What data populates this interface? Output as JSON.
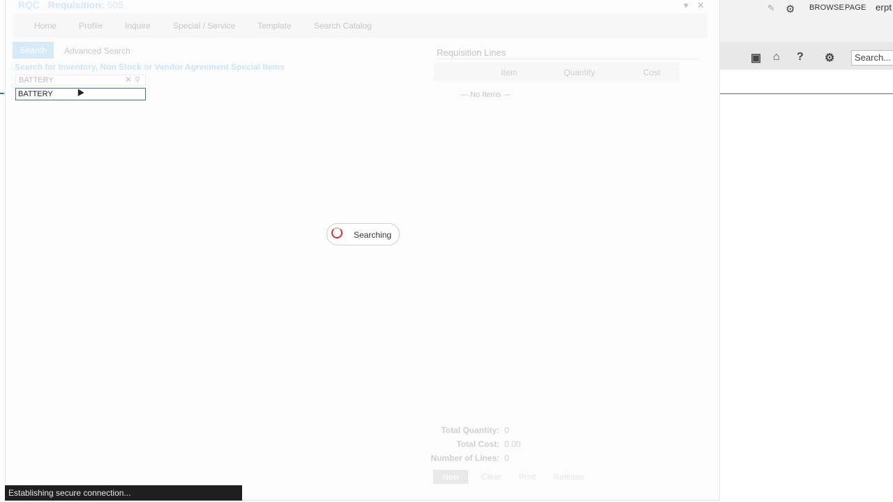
{
  "background": {
    "topbar": {
      "browse": "BROWSE",
      "page": "PAGE",
      "user": "erpt"
    },
    "ribbon": {
      "search_placeholder": "Search..."
    }
  },
  "modal": {
    "code": "RQC",
    "title_label": "Requisition:",
    "title_number": "505",
    "nav": [
      "Home",
      "Profile",
      "Inquire",
      "Special / Service",
      "Template",
      "Search Catalog"
    ],
    "tabs": {
      "search": "Search",
      "advanced": "Advanced Search"
    },
    "subtitle": "Search for Inventory, Non Stock or Vendor Agreement Special Items",
    "search": {
      "value": "BATTERY"
    },
    "autocomplete": [
      "BATTERY"
    ],
    "requisition_lines": {
      "title": "Requisition Lines",
      "columns": [
        "Item",
        "Quantity",
        "Cost"
      ],
      "empty": "--- No Items ---"
    },
    "totals": [
      {
        "label": "Total Quantity:",
        "value": "0"
      },
      {
        "label": "Total Cost:",
        "value": "0.00"
      },
      {
        "label": "Number of Lines:",
        "value": "0"
      }
    ],
    "buttons": {
      "new": "New",
      "clear": "Clear",
      "print": "Print",
      "release": "Release"
    }
  },
  "loading": {
    "text": "Searching"
  },
  "status_bar": {
    "text": "Establishing secure connection..."
  },
  "colors": {
    "accent": "#1f7bc8",
    "spinner": "#d9302c"
  }
}
